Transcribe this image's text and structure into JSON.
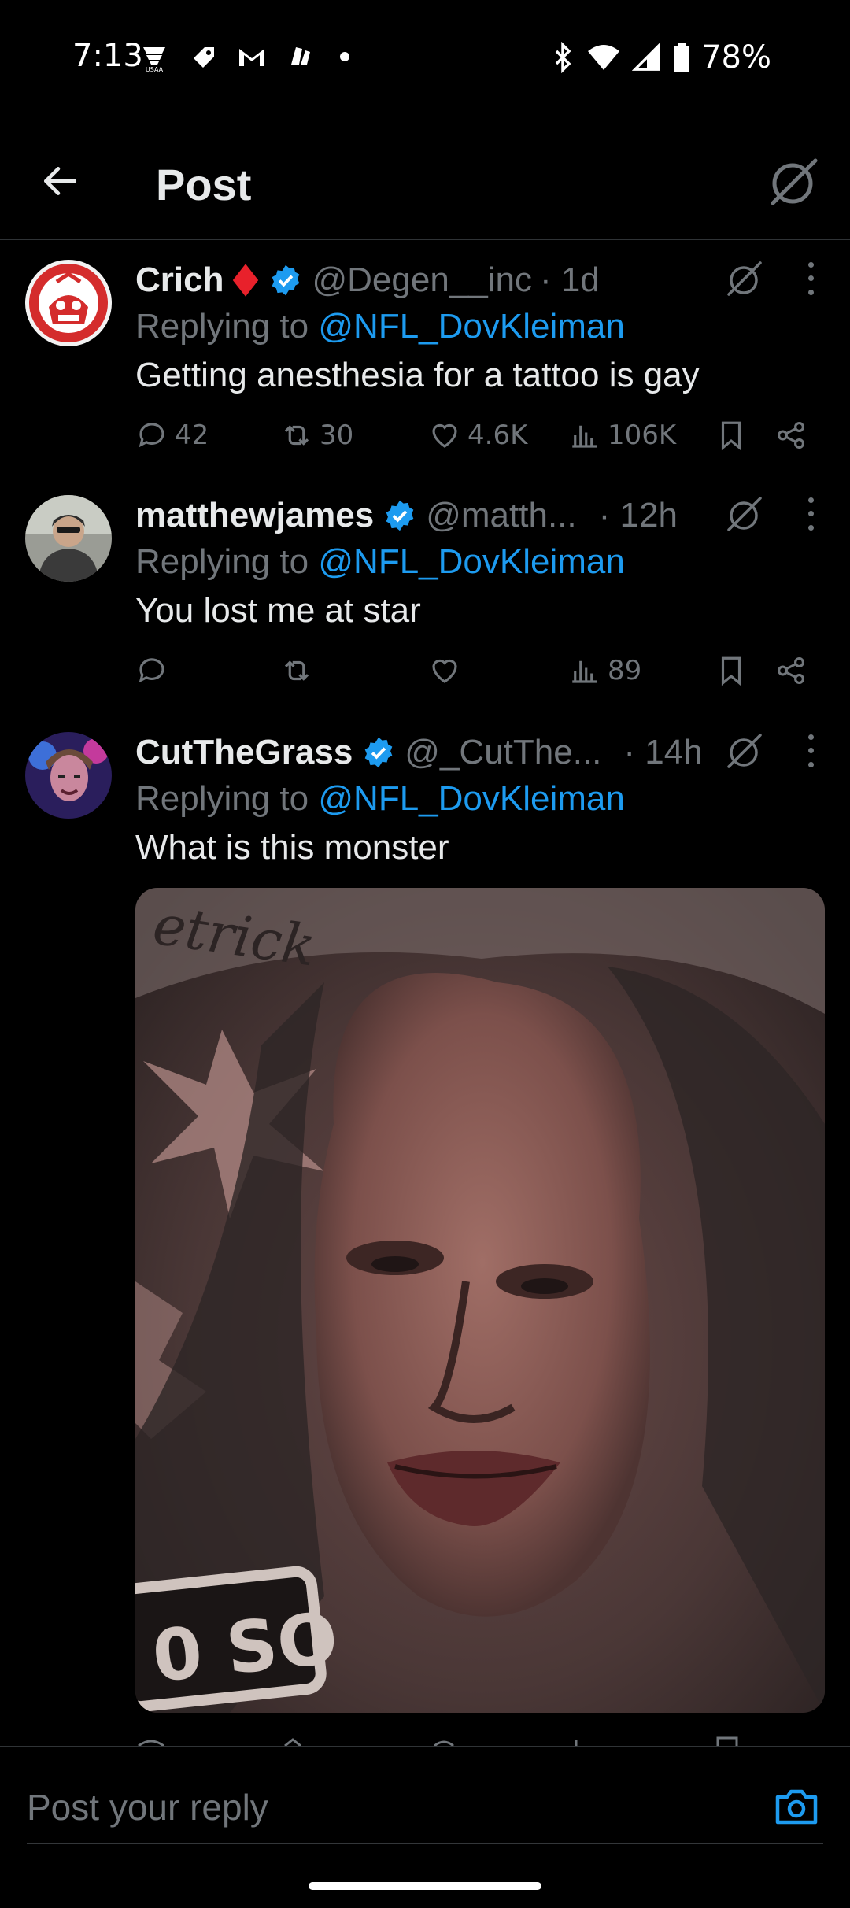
{
  "status_bar": {
    "time": "7:13",
    "battery": "78%"
  },
  "header": {
    "title": "Post"
  },
  "tweets": [
    {
      "name": "Crich",
      "handle": "@Degen__inc",
      "time": "· 1d",
      "reply_prefix": "Replying to",
      "reply_to": "@NFL_DovKleiman",
      "text": "Getting anesthesia for a tattoo is gay",
      "replies": "42",
      "reposts": "30",
      "likes": "4.6K",
      "views": "106K"
    },
    {
      "name": "matthewjames",
      "handle": "@matth...",
      "time": "· 12h",
      "reply_prefix": "Replying to",
      "reply_to": "@NFL_DovKleiman",
      "text": "You lost me at star",
      "replies": "",
      "reposts": "",
      "likes": "",
      "views": "89"
    },
    {
      "name": "CutTheGrass",
      "handle": "@_CutThe...",
      "time": "· 14h",
      "reply_prefix": "Replying to",
      "reply_to": "@NFL_DovKleiman",
      "text": "What is this monster",
      "image_texts": [
        "etrick",
        "0 SO"
      ]
    }
  ],
  "composer": {
    "placeholder": "Post your reply"
  },
  "colors": {
    "accent": "#1d9bf0",
    "muted": "#71767b",
    "text": "#e7e9ea",
    "background": "#000000",
    "diamond": "#e8212b"
  }
}
